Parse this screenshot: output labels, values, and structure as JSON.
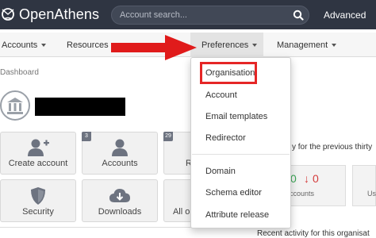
{
  "header": {
    "brand": "OpenAthens",
    "search_placeholder": "Account search...",
    "advanced_label": "Advanced"
  },
  "nav": {
    "items": [
      {
        "label": "Accounts"
      },
      {
        "label": "Resources"
      },
      {
        "label": "Preferences"
      },
      {
        "label": "Management"
      }
    ]
  },
  "breadcrumb": "Dashboard",
  "tiles": [
    {
      "label": "Create account",
      "icon": "add-user-icon",
      "badge": ""
    },
    {
      "label": "Accounts",
      "icon": "user-icon",
      "badge": "3"
    },
    {
      "label": "R",
      "icon": "",
      "badge": "29"
    },
    {
      "label": "Security",
      "icon": "shield-icon",
      "badge": ""
    },
    {
      "label": "Downloads",
      "icon": "cloud-download-icon",
      "badge": ""
    },
    {
      "label": "All or",
      "icon": "",
      "badge": ""
    }
  ],
  "stats": {
    "period_text": "y for the previous thirty",
    "count_green": "0",
    "count_red_arrow": "↓",
    "count_red": "0",
    "accounts_label": "ccounts",
    "second_label": "Us",
    "recent_activity": "Recent activity for this organisat"
  },
  "dropdown": {
    "group1": [
      "Organisation",
      "Account",
      "Email templates",
      "Redirector"
    ],
    "group2": [
      "Domain",
      "Schema editor",
      "Attribute release"
    ]
  },
  "colors": {
    "topbar": "#2f3542",
    "highlight": "#e52626",
    "arrow": "#e01b1b",
    "green": "#3aa655",
    "red": "#d43b3b"
  }
}
